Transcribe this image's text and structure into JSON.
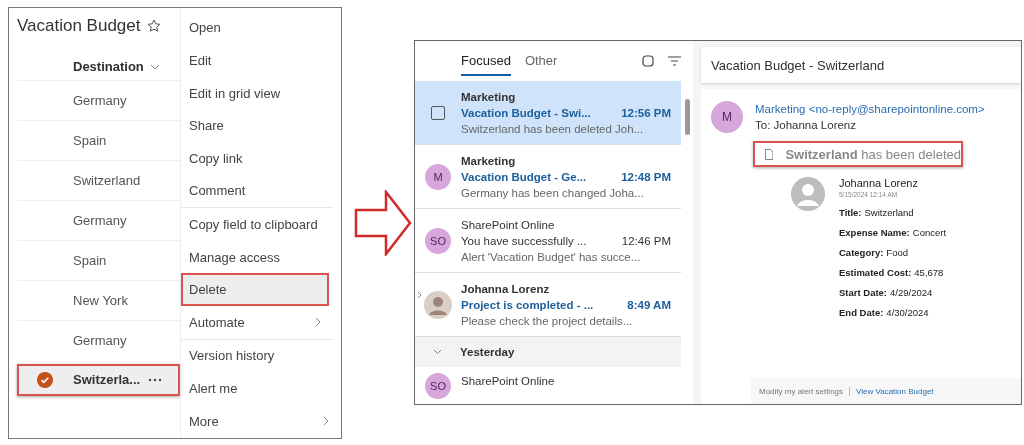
{
  "list_panel": {
    "title": "Vacation Budget",
    "column_header": "Destination",
    "rows": [
      {
        "destination": "Germany",
        "selected": false,
        "highlighted": false
      },
      {
        "destination": "Spain",
        "selected": false,
        "highlighted": false
      },
      {
        "destination": "Switzerland",
        "selected": false,
        "highlighted": false
      },
      {
        "destination": "Germany",
        "selected": false,
        "highlighted": false
      },
      {
        "destination": "Spain",
        "selected": false,
        "highlighted": false
      },
      {
        "destination": "New York",
        "selected": false,
        "highlighted": false
      },
      {
        "destination": "Germany",
        "selected": false,
        "highlighted": false
      },
      {
        "destination": "Switzerla...",
        "selected": true,
        "highlighted": true
      }
    ]
  },
  "context_menu": {
    "items": [
      {
        "label": "Open",
        "submenu": false,
        "highlighted": false,
        "divider_after": false
      },
      {
        "label": "Edit",
        "submenu": false,
        "highlighted": false,
        "divider_after": false
      },
      {
        "label": "Edit in grid view",
        "submenu": false,
        "highlighted": false,
        "divider_after": false
      },
      {
        "label": "Share",
        "submenu": false,
        "highlighted": false,
        "divider_after": false
      },
      {
        "label": "Copy link",
        "submenu": false,
        "highlighted": false,
        "divider_after": false
      },
      {
        "label": "Comment",
        "submenu": false,
        "highlighted": false,
        "divider_after": true
      },
      {
        "label": "Copy field to clipboard",
        "submenu": false,
        "highlighted": false,
        "divider_after": false
      },
      {
        "label": "Manage access",
        "submenu": false,
        "highlighted": false,
        "divider_after": false
      },
      {
        "label": "Delete",
        "submenu": false,
        "highlighted": true,
        "divider_after": false
      },
      {
        "label": "Automate",
        "submenu": true,
        "highlighted": false,
        "divider_after": true
      },
      {
        "label": "Version history",
        "submenu": false,
        "highlighted": false,
        "divider_after": false
      },
      {
        "label": "Alert me",
        "submenu": false,
        "highlighted": false,
        "divider_after": false
      },
      {
        "label": "More",
        "submenu": true,
        "highlighted": false,
        "divider_after": false
      }
    ]
  },
  "message_list": {
    "tabs": [
      {
        "label": "Focused",
        "selected": true
      },
      {
        "label": "Other",
        "selected": false
      }
    ],
    "messages": [
      {
        "kind": "checkbox",
        "sender": "Marketing",
        "subject": "Vacation Budget - Swi...",
        "time": "12:56 PM",
        "preview": "Switzerland has been deleted Joh...",
        "unread": true,
        "selected": true,
        "thread": false
      },
      {
        "kind": "initials",
        "initials": "M",
        "sender": "Marketing",
        "subject": "Vacation Budget - Ge...",
        "time": "12:48 PM",
        "preview": "Germany has been changed Joha...",
        "unread": true,
        "selected": false,
        "thread": false
      },
      {
        "kind": "initials",
        "initials": "SO",
        "sender": "SharePoint Online",
        "subject": "You have successfully ...",
        "time": "12:46 PM",
        "preview": "Alert 'Vacation Budget' has succe...",
        "unread": false,
        "selected": false,
        "thread": false
      },
      {
        "kind": "photo",
        "sender": "Johanna Lorenz",
        "subject": "Project is completed - ...",
        "time": "8:49 AM",
        "preview": "Please check the project details...",
        "unread": true,
        "selected": false,
        "thread": true
      }
    ],
    "group_header": "Yesterday",
    "partial_message": {
      "initials": "SO",
      "sender": "SharePoint Online"
    }
  },
  "reading_pane": {
    "subject": "Vacation Budget - Switzerland",
    "avatar_initials": "M",
    "from": "Marketing <no-reply@sharepointonline.com>",
    "to": "To: Johanna Lorenz",
    "notice": "**Switzerland** has been deleted",
    "card": {
      "name": "Johanna Lorenz",
      "date": "5/15/2024 12:14 AM",
      "fields": [
        {
          "label": "Title:",
          "value": "Switzerland"
        },
        {
          "label": "Expense Name:",
          "value": "Concert"
        },
        {
          "label": "Category:",
          "value": "Food"
        },
        {
          "label": "Estimated Cost:",
          "value": "45,678"
        },
        {
          "label": "Start Date:",
          "value": "4/29/2024"
        },
        {
          "label": "End Date:",
          "value": "4/30/2024"
        }
      ]
    },
    "footer_links": [
      "Modify my alert settings",
      "View Vacation Budget"
    ]
  }
}
